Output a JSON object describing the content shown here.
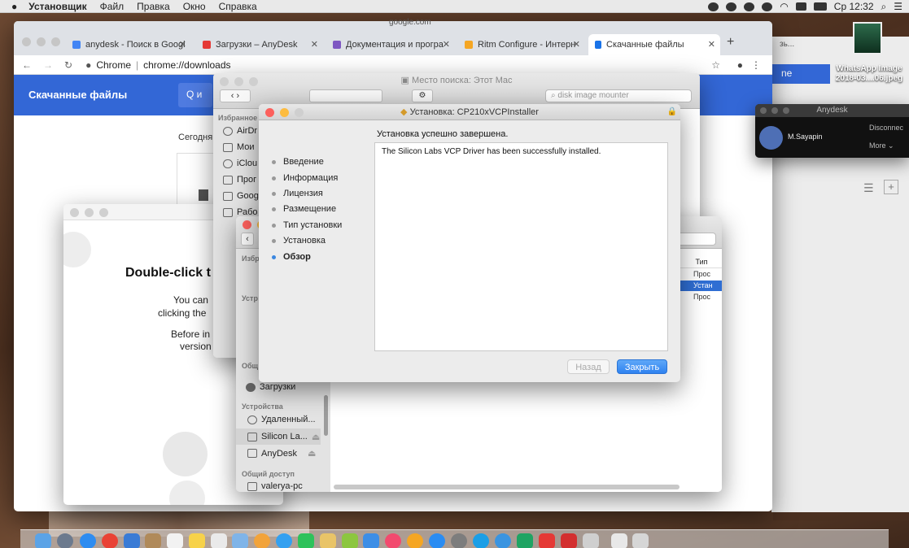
{
  "menubar": {
    "app": "Установщик",
    "menus": [
      "Файл",
      "Правка",
      "Окно",
      "Справка"
    ],
    "clock": "Ср 12:32"
  },
  "finder_top_title": "google.com",
  "chrome": {
    "tabs": [
      {
        "label": "anydesk - Поиск в Googl"
      },
      {
        "label": "Загрузки – AnyDesk"
      },
      {
        "label": "Документация и програ"
      },
      {
        "label": "Ritm Configure - Интерн"
      },
      {
        "label": "Скачанные файлы"
      }
    ],
    "url_prefix": "Chrome",
    "url": "chrome://downloads",
    "page_title": "Скачанные файлы",
    "today_label": "Сегодня",
    "search_glyph": "Q и"
  },
  "instruction_window": {
    "title": "Double-click t",
    "line1": "You can",
    "line2": "clicking the",
    "line3": "Before in",
    "line4": "version b"
  },
  "finder": {
    "title": "Место поиска: Этот Mac",
    "search_value": "disk image mounter",
    "sidebar_favorites": "Избранное",
    "favorites": [
      "AirDr",
      "Мои",
      "iClou",
      "Прог",
      "Goog",
      "Рабо"
    ],
    "sidebar_devices": "Устройства",
    "devices": [
      "Удаленный...",
      "Silicon La...",
      "AnyDesk"
    ],
    "sidebar_shared": "Общий доступ",
    "shared": [
      "valerya-pc"
    ],
    "downloads_item": "Загрузки",
    "col_type": "Тип",
    "col_p": "р",
    "rows": [
      "Прос",
      "Устан",
      "Прос"
    ]
  },
  "finder2": {
    "fav_header": "Избр",
    "dev_header": "Устр",
    "shared_header": "Общ"
  },
  "installer": {
    "title": "Установка: CP210xVCPInstaller",
    "steps": [
      "Введение",
      "Информация",
      "Лицензия",
      "Размещение",
      "Тип установки",
      "Установка",
      "Обзор"
    ],
    "heading": "Установка успешно завершена.",
    "message": "The Silicon Labs VCP Driver has been successfully installed.",
    "back_button": "Назад",
    "close_button": "Закрыть"
  },
  "anydesk": {
    "title": "Anydesk",
    "user": "M.Sayapin",
    "disconnect": "Disconnec",
    "more": "More"
  },
  "desktop_file": {
    "label": "WhatsApp Image 2018-03....06.jpeg"
  },
  "right_window_partial": {
    "fragment": "зь...",
    "fragment2": "ne"
  }
}
